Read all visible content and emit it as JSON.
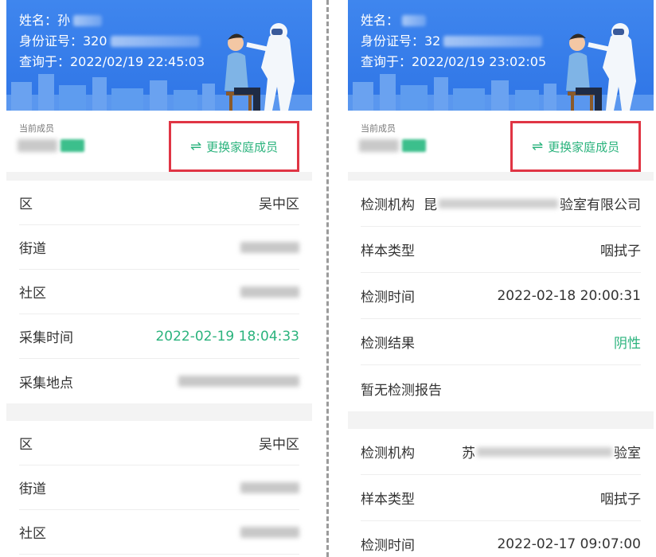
{
  "left": {
    "header": {
      "name_label": "姓名：孙",
      "id_label": "身份证号：320",
      "query_label": "查询于：2022/02/19 22:45:03"
    },
    "member": {
      "caption": "当前成员",
      "tag": "本人",
      "switch_label": "更换家庭成员",
      "switch_icon": "⇌"
    },
    "record1": [
      {
        "label": "区",
        "value": "吴中区"
      },
      {
        "label": "街道",
        "value": ""
      },
      {
        "label": "社区",
        "value": ""
      },
      {
        "label": "采集时间",
        "value": "2022-02-19 18:04:33"
      },
      {
        "label": "采集地点",
        "value": ""
      }
    ],
    "record2": [
      {
        "label": "区",
        "value": "吴中区"
      },
      {
        "label": "街道",
        "value": ""
      },
      {
        "label": "社区",
        "value": ""
      }
    ]
  },
  "right": {
    "header": {
      "name_label": "姓名：",
      "id_label": "身份证号：32",
      "query_label": "查询于：2022/02/19 23:02:05"
    },
    "member": {
      "caption": "当前成员",
      "switch_label": "更换家庭成员",
      "switch_icon": "⇌"
    },
    "record1": [
      {
        "label": "检测机构",
        "value_start": "昆",
        "value_end": "验室有限公司"
      },
      {
        "label": "样本类型",
        "value": "咽拭子"
      },
      {
        "label": "检测时间",
        "value": "2022-02-18 20:00:31"
      },
      {
        "label": "检测结果",
        "value": "阴性"
      },
      {
        "label": "暂无检测报告",
        "value": ""
      }
    ],
    "record2": [
      {
        "label": "检测机构",
        "value_start": "苏",
        "value_end": "验室"
      },
      {
        "label": "样本类型",
        "value": "咽拭子"
      },
      {
        "label": "检测时间",
        "value": "2022-02-17 09:07:00"
      }
    ]
  },
  "colors": {
    "header_blue": "#3a80ec",
    "accent_green": "#2bb37d",
    "highlight_red": "#e03544"
  }
}
